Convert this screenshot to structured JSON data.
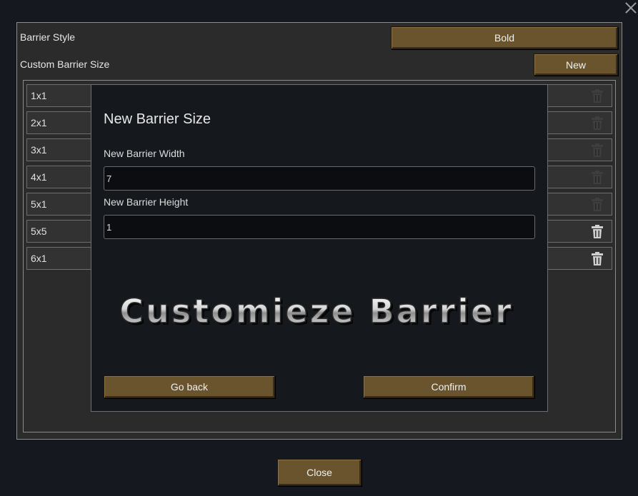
{
  "window": {
    "close_icon": "close-x-icon"
  },
  "settings": {
    "barrier_style_label": "Barrier Style",
    "barrier_style_value": "Bold",
    "custom_size_label": "Custom Barrier Size",
    "new_button_label": "New"
  },
  "sizes": {
    "items": [
      {
        "label": "1x1"
      },
      {
        "label": "2x1"
      },
      {
        "label": "3x1"
      },
      {
        "label": "4x1"
      },
      {
        "label": "5x1"
      },
      {
        "label": "5x5"
      },
      {
        "label": "6x1"
      }
    ],
    "delete_icon": "trash-icon"
  },
  "dialog": {
    "title": "New Barrier Size",
    "width_label": "New Barrier Width",
    "width_value": "7",
    "height_label": "New Barrier Height",
    "height_value": "1",
    "banner_text": "Customieze Barrier",
    "go_back_label": "Go back",
    "confirm_label": "Confirm"
  },
  "footer": {
    "close_label": "Close"
  },
  "colors": {
    "wood_button": "#6a542d",
    "panel_bg": "#2b2b2b",
    "dialog_bg": "#15191e"
  }
}
